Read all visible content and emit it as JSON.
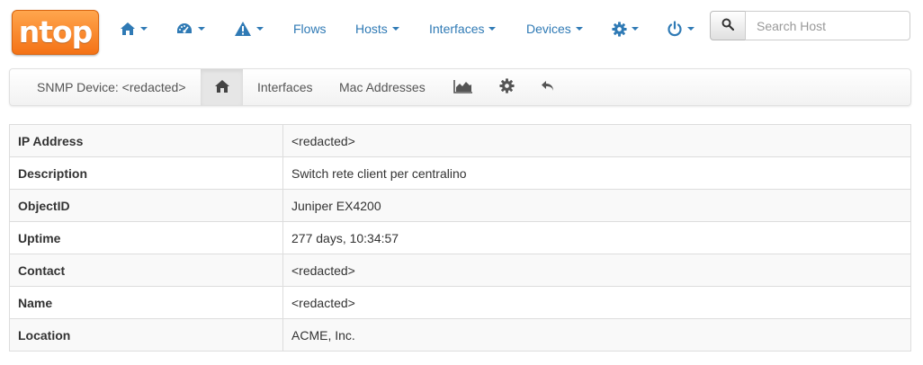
{
  "brand": {
    "logo_text": "ntop"
  },
  "nav": {
    "flows": "Flows",
    "hosts": "Hosts",
    "interfaces": "Interfaces",
    "devices": "Devices"
  },
  "search": {
    "placeholder": "Search Host",
    "value": ""
  },
  "subnav": {
    "device_label": "SNMP Device: <redacted>",
    "interfaces": "Interfaces",
    "mac_addresses": "Mac Addresses"
  },
  "device_info": [
    {
      "key": "IP Address",
      "value": "<redacted>"
    },
    {
      "key": "Description",
      "value": "Switch rete client per centralino"
    },
    {
      "key": "ObjectID",
      "value": "Juniper EX4200"
    },
    {
      "key": "Uptime",
      "value": "277 days, 10:34:57"
    },
    {
      "key": "Contact",
      "value": "<redacted>"
    },
    {
      "key": "Name",
      "value": "<redacted>"
    },
    {
      "key": "Location",
      "value": "ACME, Inc."
    }
  ],
  "colors": {
    "link": "#2f7ab5",
    "brand_orange": "#f47216"
  },
  "icons": [
    "home-icon",
    "dashboard-icon",
    "alert-icon",
    "gear-icon",
    "power-icon",
    "search-icon",
    "chart-icon",
    "undo-icon"
  ]
}
